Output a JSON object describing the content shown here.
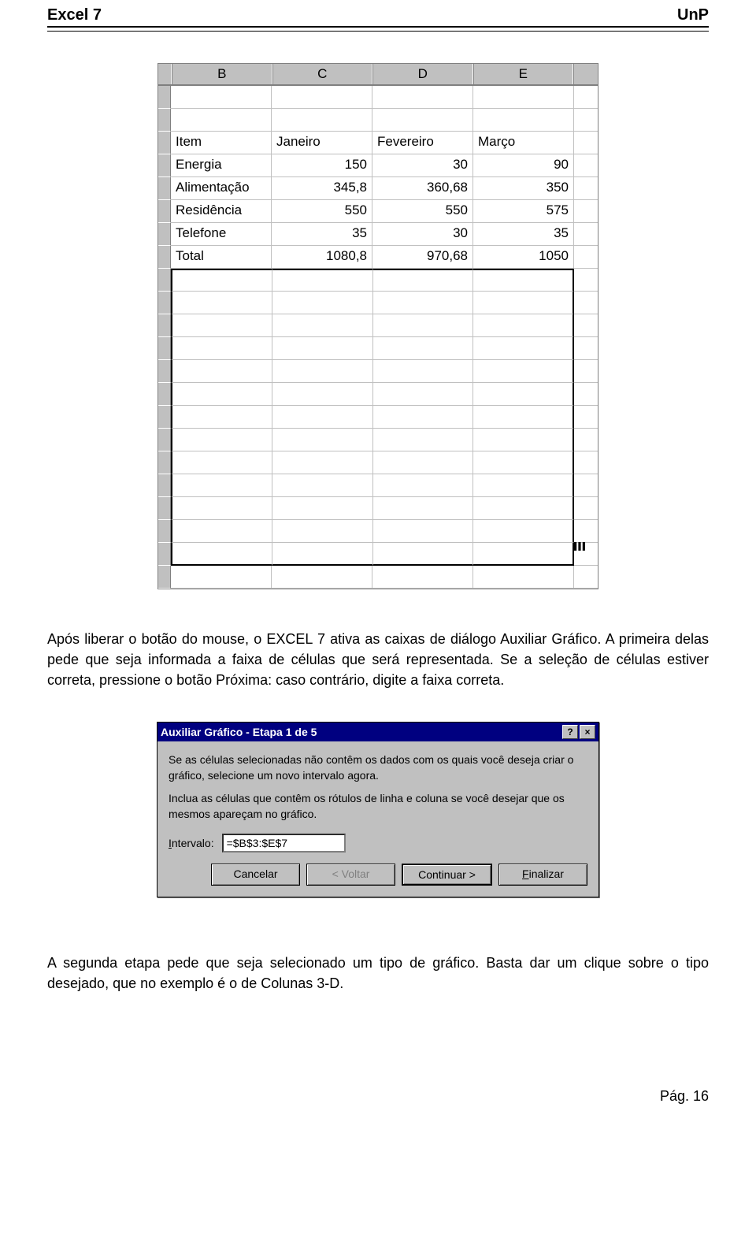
{
  "header": {
    "left": "Excel 7",
    "right": "UnP"
  },
  "spreadsheet": {
    "columns": [
      "B",
      "C",
      "D",
      "E"
    ],
    "data_rows": [
      {
        "b": "Item",
        "c": "Janeiro",
        "d": "Fevereiro",
        "e": "Março",
        "numeric": false
      },
      {
        "b": "Energia",
        "c": "150",
        "d": "30",
        "e": "90",
        "numeric": true
      },
      {
        "b": "Alimentação",
        "c": "345,8",
        "d": "360,68",
        "e": "350",
        "numeric": true
      },
      {
        "b": "Residência",
        "c": "550",
        "d": "550",
        "e": "575",
        "numeric": true
      },
      {
        "b": "Telefone",
        "c": "35",
        "d": "30",
        "e": "35",
        "numeric": true
      },
      {
        "b": "Total",
        "c": "1080,8",
        "d": "970,68",
        "e": "1050",
        "numeric": true
      }
    ],
    "blank_rows_before": 2,
    "blank_rows_after": 14
  },
  "paragraph1": "Após liberar o botão do mouse, o EXCEL 7 ativa as caixas de diálogo Auxiliar Gráfico.  A primeira delas pede que seja informada a faixa de células que será representada.  Se a seleção de células estiver correta, pressione o botão Próxima:  caso contrário, digite a faixa correta.",
  "dialog": {
    "title": "Auxiliar Gráfico - Etapa 1 de 5",
    "text1": "Se as células selecionadas não contêm os dados com os quais você deseja criar o gráfico, selecione um novo intervalo agora.",
    "text2": "Inclua as células que contêm os rótulos de linha e coluna se você desejar que os mesmos apareçam no gráfico.",
    "interval_label_pre": "I",
    "interval_label_rest": "ntervalo:",
    "interval_value": "=$B$3:$E$7",
    "buttons": {
      "cancel": "Cancelar",
      "back": "< Voltar",
      "next": "Continuar >",
      "finish": "Finalizar"
    }
  },
  "paragraph2": "A segunda etapa pede que seja selecionado um tipo de gráfico.  Basta dar um clique sobre o tipo desejado, que no exemplo é o de Colunas 3-D.",
  "footer": "Pág. 16",
  "chart_data": {
    "type": "table",
    "title": "",
    "columns": [
      "Item",
      "Janeiro",
      "Fevereiro",
      "Março"
    ],
    "rows": [
      [
        "Energia",
        150,
        30,
        90
      ],
      [
        "Alimentação",
        345.8,
        360.68,
        350
      ],
      [
        "Residência",
        550,
        550,
        575
      ],
      [
        "Telefone",
        35,
        30,
        35
      ],
      [
        "Total",
        1080.8,
        970.68,
        1050
      ]
    ]
  }
}
